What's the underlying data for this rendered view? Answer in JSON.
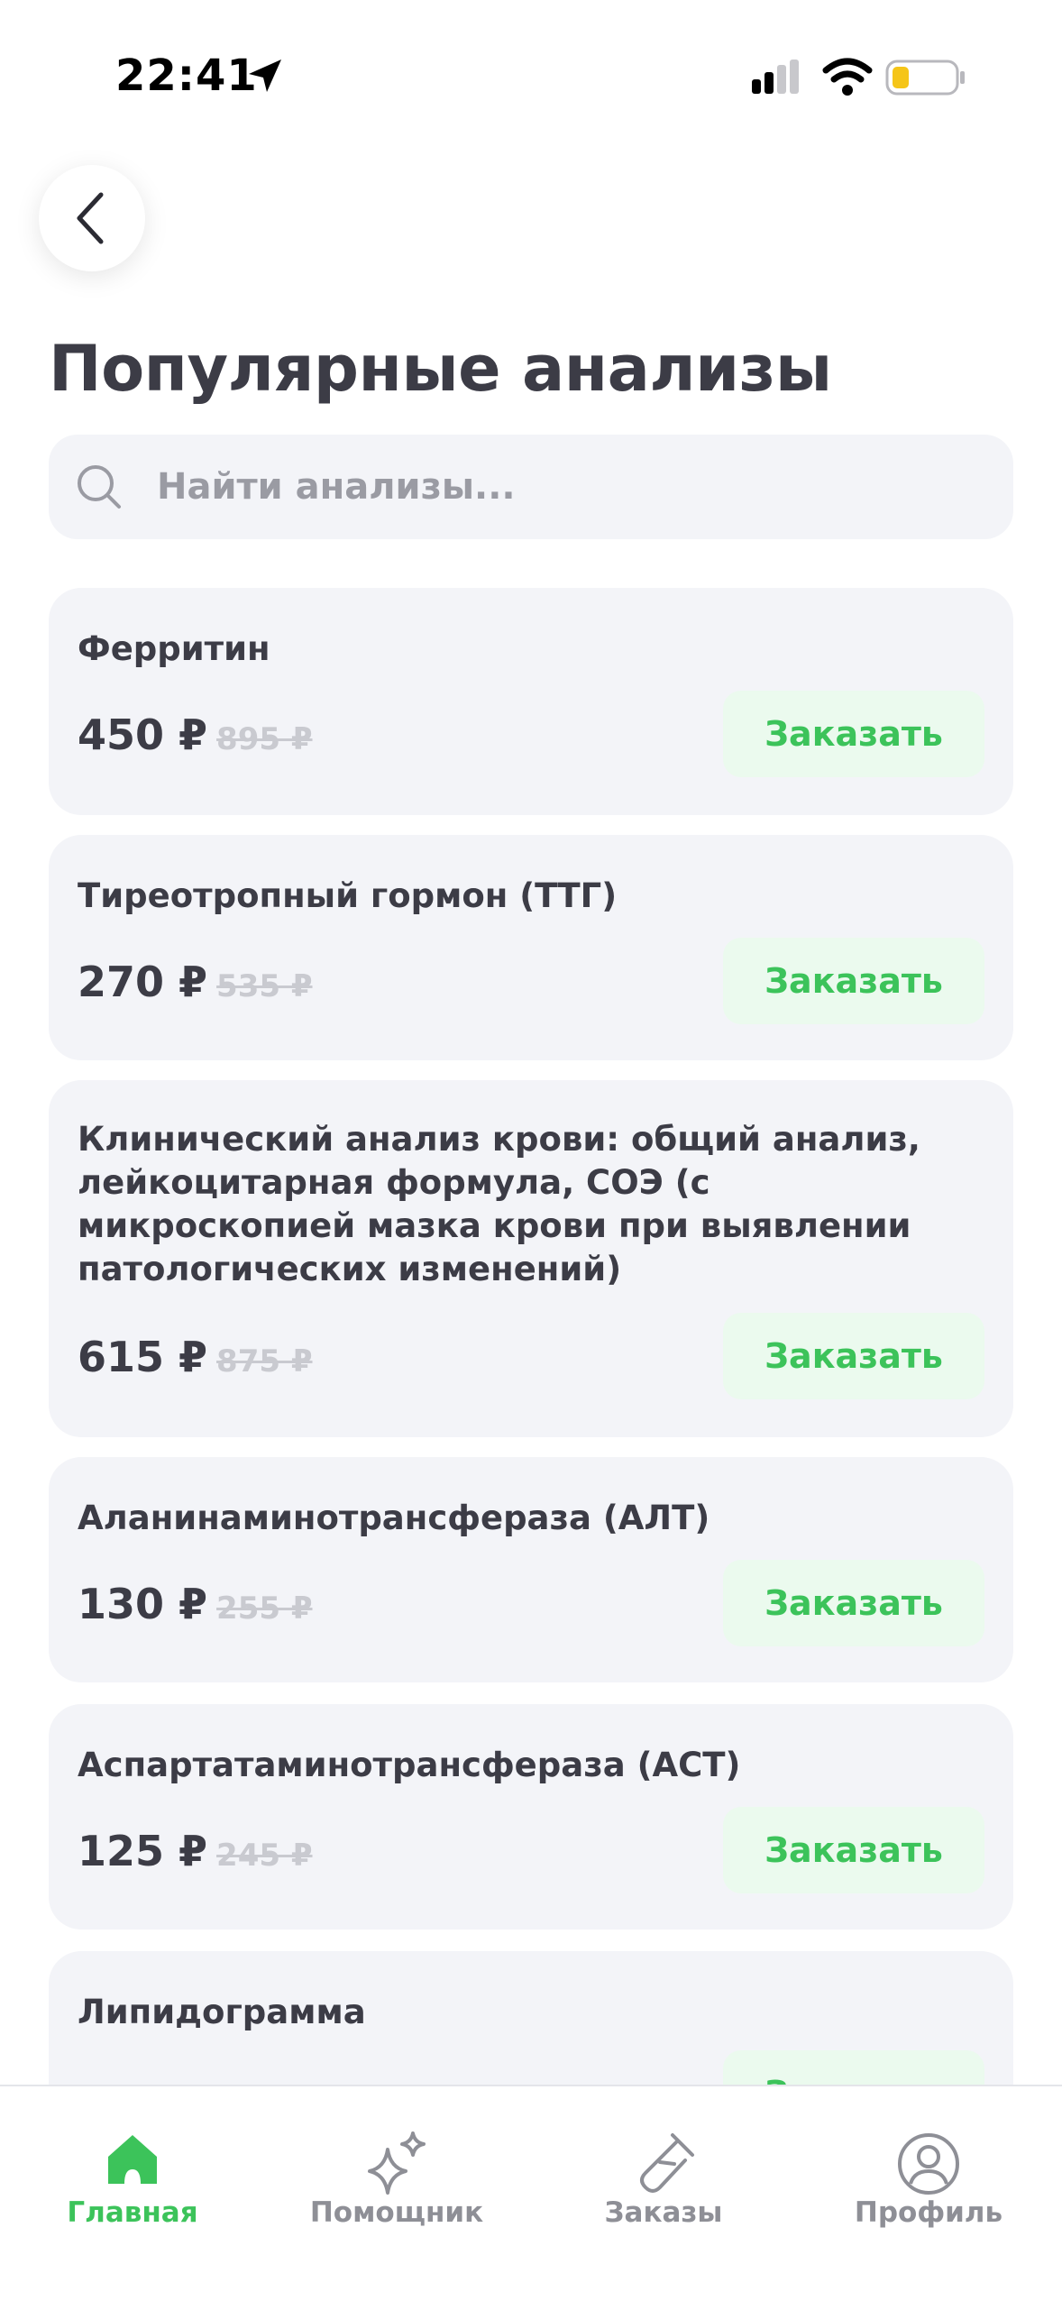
{
  "status_bar": {
    "time": "22:41",
    "icons": [
      "location-arrow-icon",
      "cellular-signal-icon",
      "wifi-icon",
      "battery-low-icon"
    ]
  },
  "header": {
    "back_icon": "chevron-left-icon",
    "title": "Популярные анализы"
  },
  "search": {
    "placeholder": "Найти анализы...",
    "value": "",
    "icon": "search-icon"
  },
  "tests": [
    {
      "name": "Ферритин",
      "price": "450 ₽",
      "old_price": "895 ₽",
      "button": "Заказать"
    },
    {
      "name": "Тиреотропный гормон (ТТГ)",
      "price": "270 ₽",
      "old_price": "535 ₽",
      "button": "Заказать"
    },
    {
      "name": "Клинический анализ крови: общий анализ, лейкоцитарная формула, СОЭ (с микроскопией мазка крови при выявлении патологических изменений)",
      "price": "615 ₽",
      "old_price": "875 ₽",
      "button": "Заказать"
    },
    {
      "name": "Аланинаминотрансфераза (АЛТ)",
      "price": "130 ₽",
      "old_price": "255 ₽",
      "button": "Заказать"
    },
    {
      "name": "Аспартатаминотрансфераза (АСТ)",
      "price": "125 ₽",
      "old_price": "245 ₽",
      "button": "Заказать"
    },
    {
      "name": "Липидограмма",
      "price": "",
      "old_price": "",
      "button": "Заказать"
    }
  ],
  "tab_bar": {
    "tabs": [
      {
        "label": "Главная",
        "icon": "home-icon",
        "active": true
      },
      {
        "label": "Помощник",
        "icon": "sparkles-icon",
        "active": false
      },
      {
        "label": "Заказы",
        "icon": "test-tube-icon",
        "active": false
      },
      {
        "label": "Профиль",
        "icon": "profile-icon",
        "active": false
      }
    ]
  },
  "colors": {
    "accent_green": "#3cc35a",
    "button_bg": "#ebfaee",
    "card_bg": "#f3f4f8",
    "text_dark": "#3c3c46",
    "text_muted": "#8e8f96",
    "old_price": "#c9cad0"
  }
}
